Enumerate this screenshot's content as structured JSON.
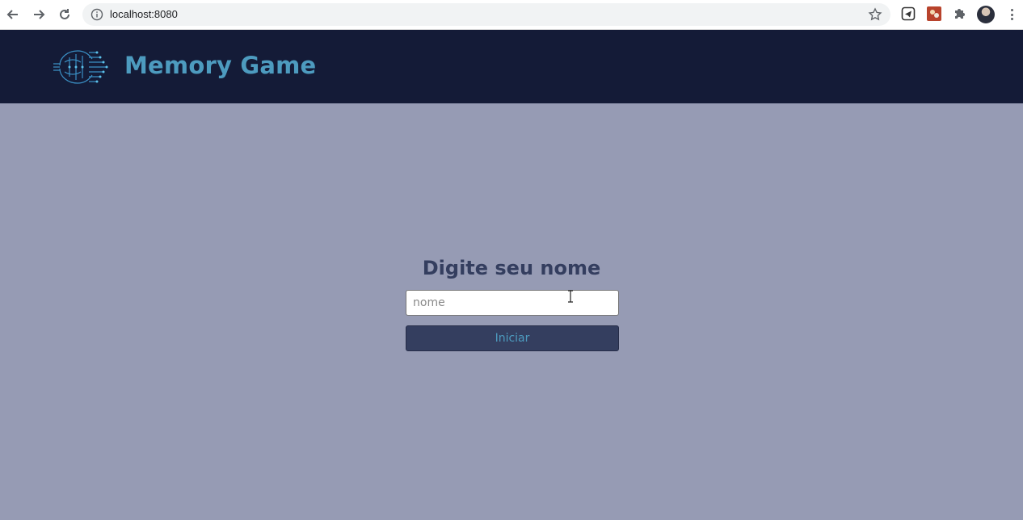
{
  "browser": {
    "url": "localhost:8080",
    "icons": {
      "back": "back-arrow-icon",
      "forward": "forward-arrow-icon",
      "reload": "reload-icon",
      "info": "info-icon",
      "bookmark": "star-icon",
      "extension_1": "telegram-extension-icon",
      "extension_2": "red-extension-icon",
      "extensions": "puzzle-icon",
      "profile": "avatar",
      "menu": "kebab-menu-icon"
    }
  },
  "header": {
    "title": "Memory Game",
    "background": "#141b37",
    "title_color": "#4d9bbf"
  },
  "form": {
    "title": "Digite seu nome",
    "name_placeholder": "nome",
    "name_value": "",
    "start_label": "Iniciar"
  },
  "colors": {
    "page_background": "#969bb4",
    "heading": "#343e5f",
    "button_background": "#343e5f",
    "button_text": "#4d9bbf"
  }
}
